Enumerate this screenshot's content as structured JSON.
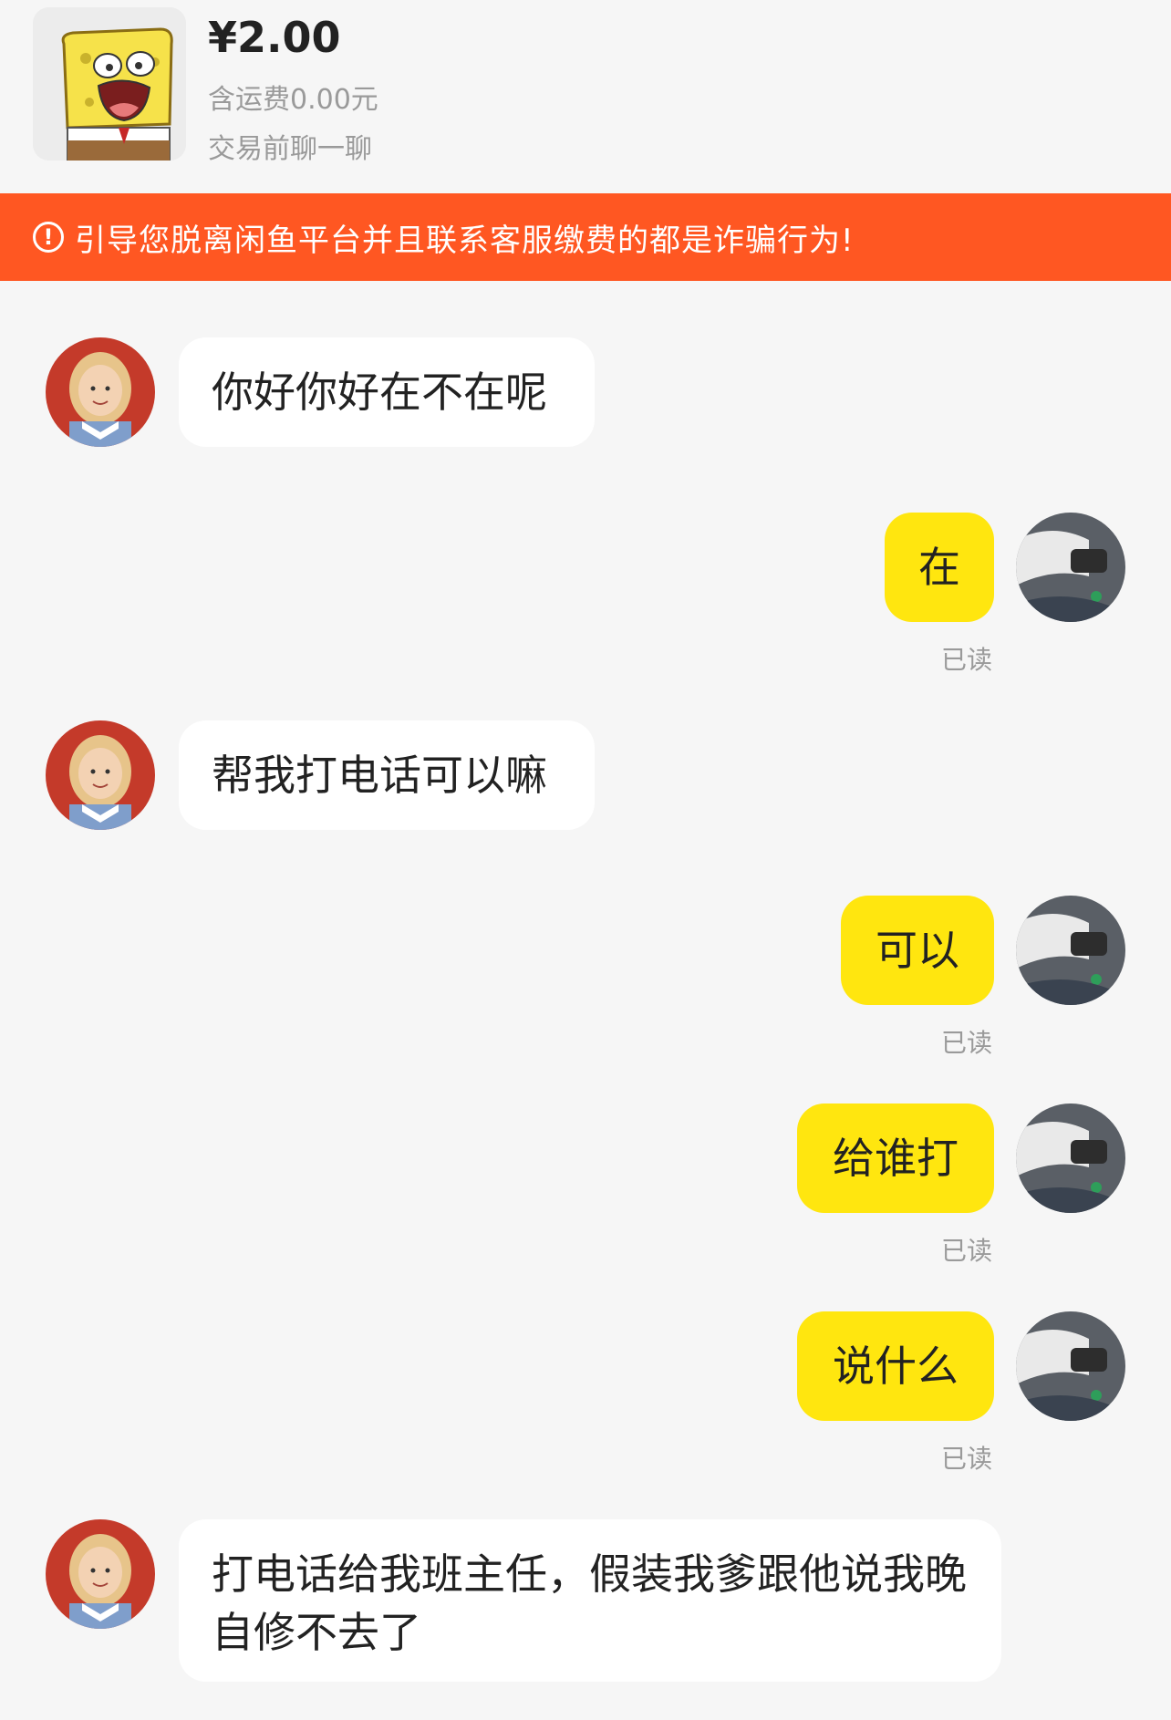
{
  "product": {
    "price": "¥2.00",
    "shipping": "含运费0.00元",
    "chat_hint": "交易前聊一聊",
    "thumbnail_icon": "spongebob-thumbnail"
  },
  "warning": {
    "icon": "exclamation-circle-icon",
    "text": "引导您脱离闲鱼平台并且联系客服缴费的都是诈骗行为!"
  },
  "colors": {
    "banner": "#ff5722",
    "my_bubble": "#ffe60f",
    "their_bubble": "#ffffff",
    "background": "#f6f6f6"
  },
  "messages": [
    {
      "sender": "other",
      "text": "你好你好在不在呢"
    },
    {
      "sender": "me",
      "text": "在",
      "status": "已读"
    },
    {
      "sender": "other",
      "text": "帮我打电话可以嘛"
    },
    {
      "sender": "me",
      "text": "可以",
      "status": "已读"
    },
    {
      "sender": "me",
      "text": "给谁打",
      "status": "已读"
    },
    {
      "sender": "me",
      "text": "说什么",
      "status": "已读"
    },
    {
      "sender": "other",
      "text": "打电话给我班主任，假装我爹跟他说我晚自修不去了"
    }
  ]
}
